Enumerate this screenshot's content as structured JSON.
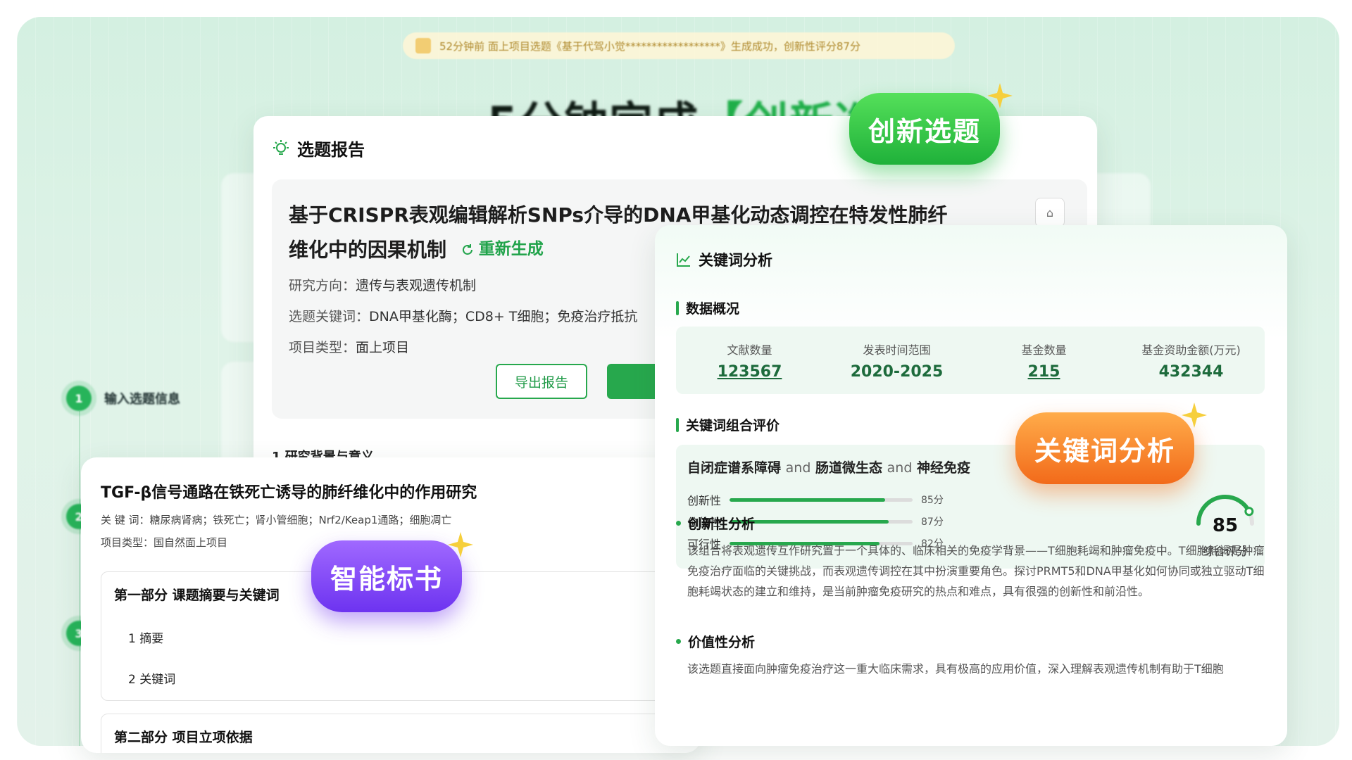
{
  "notice": {
    "text": "52分钟前 面上项目选题《基于代驾小觉******************》生成成功，创新性评分87分"
  },
  "hero": {
    "title_black": "5分钟完成",
    "title_green": "【创新选题"
  },
  "steps": [
    {
      "num": "1",
      "label": "输入选题信息"
    },
    {
      "num": "2",
      "label": ""
    },
    {
      "num": "3",
      "label": ""
    }
  ],
  "topic_card": {
    "header": "选题报告",
    "title": "基于CRISPR表观编辑解析SNPs介导的DNA甲基化动态调控在特发性肺纤维化中的因果机制",
    "regenerate": "重新生成",
    "direction_label": "研究方向：",
    "direction": "遗传与表观遗传机制",
    "keywords_label": "选题关键词：",
    "keywords": "DNA甲基化酶；CD8+ T细胞；免疫治疗抵抗",
    "type_label": "项目类型：",
    "type": "面上项目",
    "export_button": "导出报告",
    "section_peek": "1 研究背景与意义"
  },
  "keyword_card": {
    "header": "关键词分析",
    "overview_title": "数据概况",
    "stats": [
      {
        "label": "文献数量",
        "value": "123567",
        "link": true
      },
      {
        "label": "发表时间范围",
        "value": "2020-2025",
        "link": false
      },
      {
        "label": "基金数量",
        "value": "215",
        "link": true
      },
      {
        "label": "基金资助金额(万元)",
        "value": "432344",
        "link": false
      }
    ],
    "combo_title": "关键词组合评价",
    "combo": {
      "k1": "自闭症谱系障碍",
      "and1": "and",
      "k2": "肠道微生态",
      "and2": "and",
      "k3": "神经免疫"
    },
    "scores": [
      {
        "label": "创新性",
        "value": 85,
        "text": "85分"
      },
      {
        "label": "价值性",
        "value": 87,
        "text": "87分"
      },
      {
        "label": "可行性",
        "value": 82,
        "text": "82分"
      }
    ],
    "overall": {
      "value": "85",
      "caption": "综合评分",
      "fraction": 0.85
    },
    "innovation_title": "创新性分析",
    "innovation_text": "该组合将表观遗传互作研究置于一个具体的、临床相关的免疫学背景——T细胞耗竭和肿瘤免疫中。T细胞耗竭是肿瘤免疫治疗面临的关键挑战，而表观遗传调控在其中扮演重要角色。探讨PRMT5和DNA甲基化如何协同或独立驱动T细胞耗竭状态的建立和维持，是当前肿瘤免疫研究的热点和难点，具有很强的创新性和前沿性。",
    "value_title": "价值性分析",
    "value_text": "该选题直接面向肿瘤免疫治疗这一重大临床需求，具有极高的应用价值，深入理解表观遗传机制有助于T细胞"
  },
  "proposal_card": {
    "title": "TGF-β信号通路在铁死亡诱导的肺纤维化中的作用研究",
    "keywords_label": "关 键 词：",
    "keywords": "糖尿病肾病；铁死亡；肾小管细胞；Nrf2/Keap1通路；细胞凋亡",
    "type_label": "项目类型：",
    "type": "国自然面上项目",
    "part1": "第一部分 课题摘要与关键词",
    "part1_items": [
      "1 摘要",
      "2 关键词"
    ],
    "part2": "第二部分 项目立项依据"
  },
  "badges": {
    "innovation": "创新选题",
    "keyword": "关键词分析",
    "proposal": "智能标书"
  },
  "colors": {
    "brand_green": "#27a84d",
    "orange": "#f5832a",
    "purple": "#7b3ff2"
  }
}
